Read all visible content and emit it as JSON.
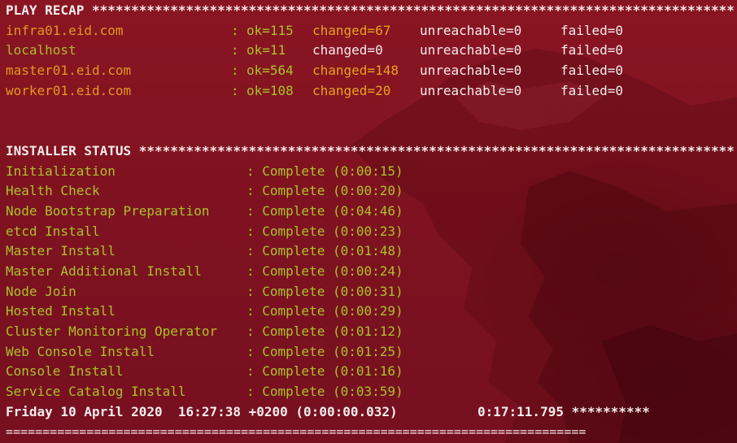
{
  "play_recap": {
    "header": "PLAY RECAP **********************************************************************************",
    "hosts": [
      {
        "name": "infra01.eid.com",
        "colon": ": ",
        "ok": "ok=115",
        "changed": "changed=67",
        "unreachable": "unreachable=0",
        "failed": "failed=0"
      },
      {
        "name": "localhost",
        "colon": ": ",
        "ok": "ok=11",
        "changed": "changed=0",
        "unreachable": "unreachable=0",
        "failed": "failed=0"
      },
      {
        "name": "master01.eid.com",
        "colon": ": ",
        "ok": "ok=564",
        "changed": "changed=148",
        "unreachable": "unreachable=0",
        "failed": "failed=0"
      },
      {
        "name": "worker01.eid.com",
        "colon": ": ",
        "ok": "ok=108",
        "changed": "changed=20",
        "unreachable": "unreachable=0",
        "failed": "failed=0"
      }
    ]
  },
  "installer_status": {
    "header": "INSTALLER STATUS ****************************************************************************",
    "phases": [
      {
        "name": "Initialization",
        "status": ": Complete (0:00:15)"
      },
      {
        "name": "Health Check",
        "status": ": Complete (0:00:20)"
      },
      {
        "name": "Node Bootstrap Preparation",
        "status": ": Complete (0:04:46)"
      },
      {
        "name": "etcd Install",
        "status": ": Complete (0:00:23)"
      },
      {
        "name": "Master Install",
        "status": ": Complete (0:01:48)"
      },
      {
        "name": "Master Additional Install",
        "status": ": Complete (0:00:24)"
      },
      {
        "name": "Node Join",
        "status": ": Complete (0:00:31)"
      },
      {
        "name": "Hosted Install",
        "status": ": Complete (0:00:29)"
      },
      {
        "name": "Cluster Monitoring Operator",
        "status": ": Complete (0:01:12)"
      },
      {
        "name": "Web Console Install",
        "status": ": Complete (0:01:25)"
      },
      {
        "name": "Console Install",
        "status": ": Complete (0:01:16)"
      },
      {
        "name": "Service Catalog Install",
        "status": ": Complete (0:03:59)"
      }
    ]
  },
  "footer": {
    "timestamp": "Friday 10 April 2020  16:27:38 +0200 (0:00:00.032)",
    "elapsed": "0:17:11.795 **********",
    "rule": "==============================================================================="
  },
  "colors": {
    "background": "#7f1220",
    "host_changed": "#e29820",
    "host_ok": "#a7bd2c",
    "ok": "#a9c22a",
    "changed": "#e6a31f",
    "text": "#f4ecec"
  }
}
